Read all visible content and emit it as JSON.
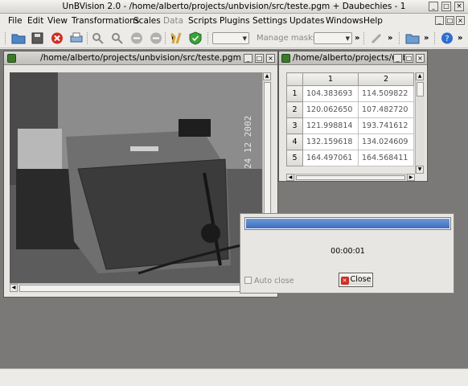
{
  "window": {
    "title": "UnBVision 2.0 - /home/alberto/projects/unbvision/src/teste.pgm + Daubechies - 1",
    "controls": {
      "minimize": "_",
      "maximize": "□",
      "close": "×"
    }
  },
  "menu": [
    "File",
    "Edit",
    "View",
    "Transformations",
    "Scales",
    "Data",
    "Scripts",
    "Plugins",
    "Settings",
    "Updates",
    "Windows",
    "Help"
  ],
  "menu_disabled": [
    "Data"
  ],
  "toolbar": {
    "icons": [
      "open-folder-icon",
      "save-icon",
      "close-red-icon",
      "print-icon",
      "zoom-in-icon",
      "zoom-out-icon",
      "undo-icon",
      "redo-icon",
      "tools-icon",
      "shield-icon"
    ],
    "manage_masks_label": "Manage masks",
    "overflow": "»"
  },
  "image_window": {
    "title": "/home/alberto/projects/unbvision/src/teste.pgm",
    "photo_date_stamp": "24 12 2002"
  },
  "table_window": {
    "title": "/home/alberto/projects/unb",
    "columns": [
      "1",
      "2"
    ],
    "rows": [
      {
        "n": "1",
        "c1": "104.383693",
        "c2": "114.509822"
      },
      {
        "n": "2",
        "c1": "120.062650",
        "c2": "107.482720"
      },
      {
        "n": "3",
        "c1": "121.998814",
        "c2": "193.741612"
      },
      {
        "n": "4",
        "c1": "132.159618",
        "c2": "134.024609"
      },
      {
        "n": "5",
        "c1": "164.497061",
        "c2": "164.568411"
      }
    ]
  },
  "progress_dialog": {
    "progress": 1.0,
    "elapsed": "00:00:01",
    "auto_close_label": "Auto close",
    "close_label": "Close",
    "close_mnemonic": "C"
  },
  "colors": {
    "workspace": "#7a7977",
    "progress": "#4a7ec8",
    "close_icon": "#d12d22"
  }
}
